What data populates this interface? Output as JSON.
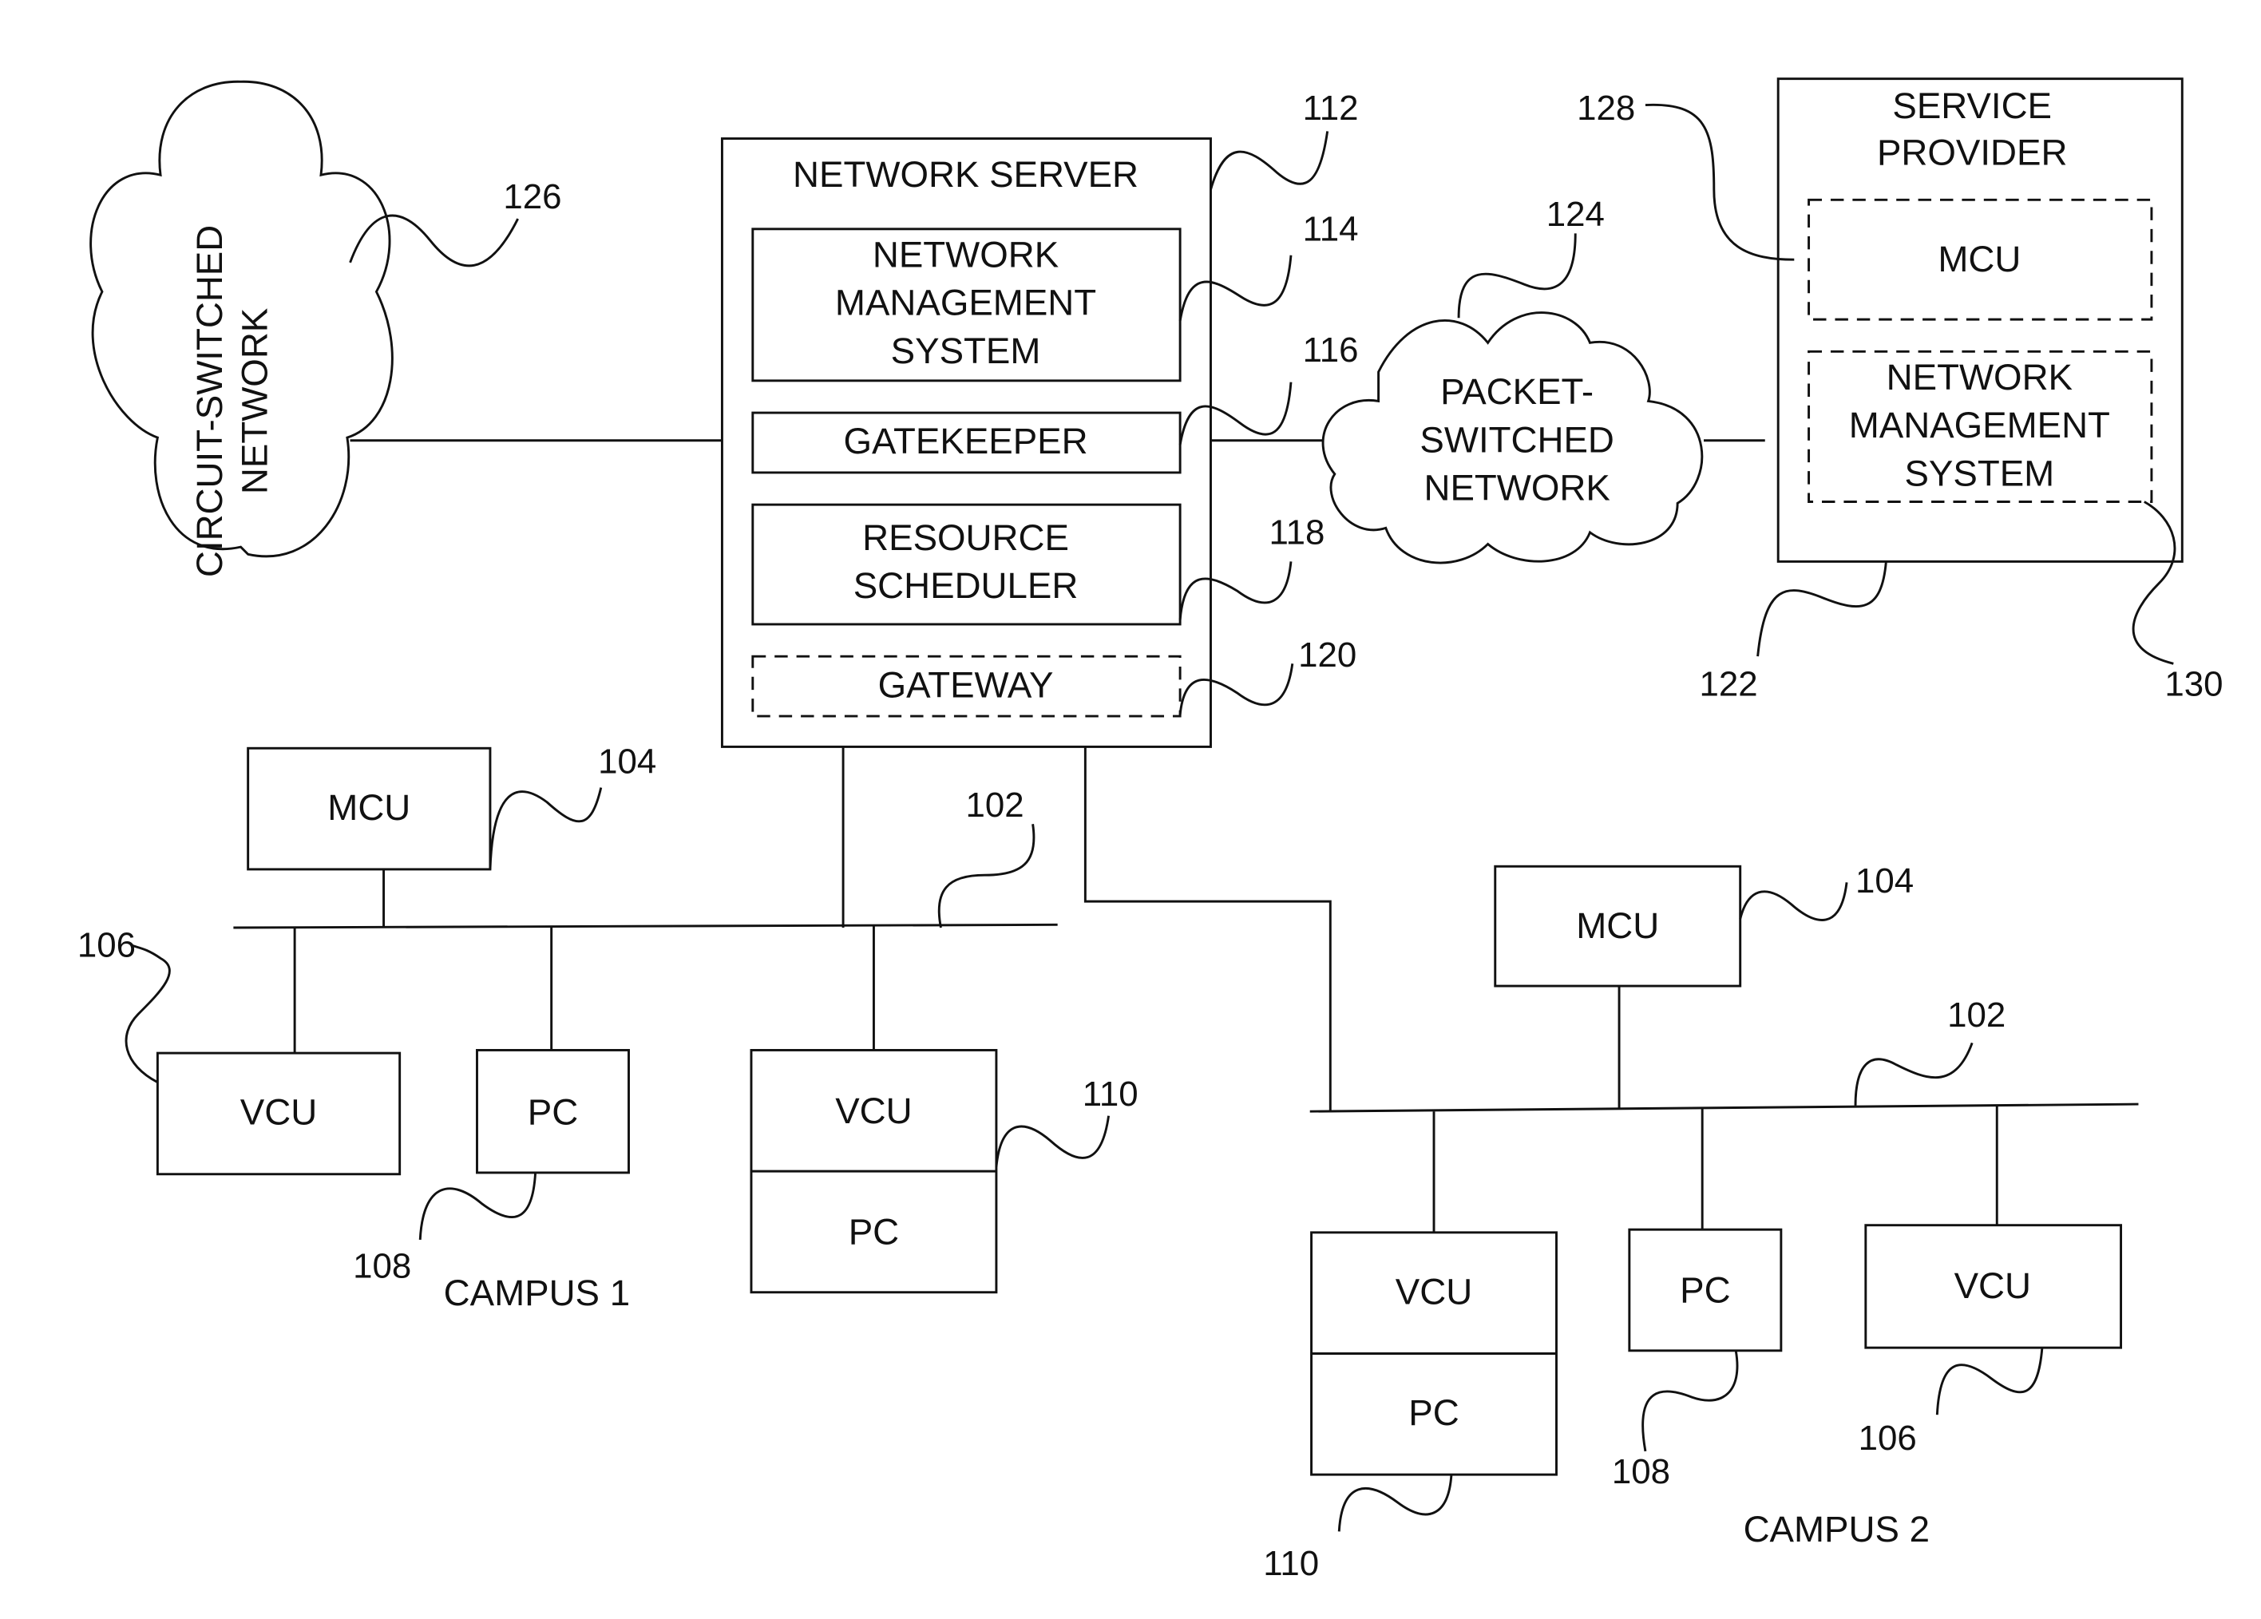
{
  "figure": {
    "network_server": {
      "title": "NETWORK SERVER",
      "ref": "112",
      "nms": {
        "lines": [
          "NETWORK",
          "MANAGEMENT",
          "SYSTEM"
        ],
        "ref": "114"
      },
      "gatekeeper": {
        "label": "GATEKEEPER",
        "ref": "116"
      },
      "resource_scheduler": {
        "lines": [
          "RESOURCE",
          "SCHEDULER"
        ],
        "ref": "118"
      },
      "gateway": {
        "label": "GATEWAY",
        "ref": "120"
      }
    },
    "circuit_network": {
      "lines": [
        "CIRCUIT-SWITCHED",
        "NETWORK"
      ],
      "ref": "126"
    },
    "packet_network": {
      "lines": [
        "PACKET-",
        "SWITCHED",
        "NETWORK"
      ],
      "ref": "124"
    },
    "service_provider": {
      "lines": [
        "SERVICE",
        "PROVIDER"
      ],
      "ref": "122",
      "mcu": {
        "label": "MCU",
        "ref": "128"
      },
      "nms": {
        "lines": [
          "NETWORK",
          "MANAGEMENT",
          "SYSTEM"
        ],
        "ref": "130"
      }
    },
    "campus1": {
      "label": "CAMPUS 1",
      "bus_ref": "102",
      "mcu": {
        "label": "MCU",
        "ref": "104"
      },
      "vcu": {
        "label": "VCU",
        "ref": "106"
      },
      "pc": {
        "label": "PC",
        "ref": "108"
      },
      "vcu_pc": {
        "top": "VCU",
        "bottom": "PC",
        "ref": "110"
      }
    },
    "campus2": {
      "label": "CAMPUS 2",
      "bus_ref": "102",
      "mcu": {
        "label": "MCU",
        "ref": "104"
      },
      "vcu": {
        "label": "VCU",
        "ref": "106"
      },
      "pc": {
        "label": "PC",
        "ref": "108"
      },
      "vcu_pc": {
        "top": "VCU",
        "bottom": "PC",
        "ref": "110"
      }
    }
  }
}
